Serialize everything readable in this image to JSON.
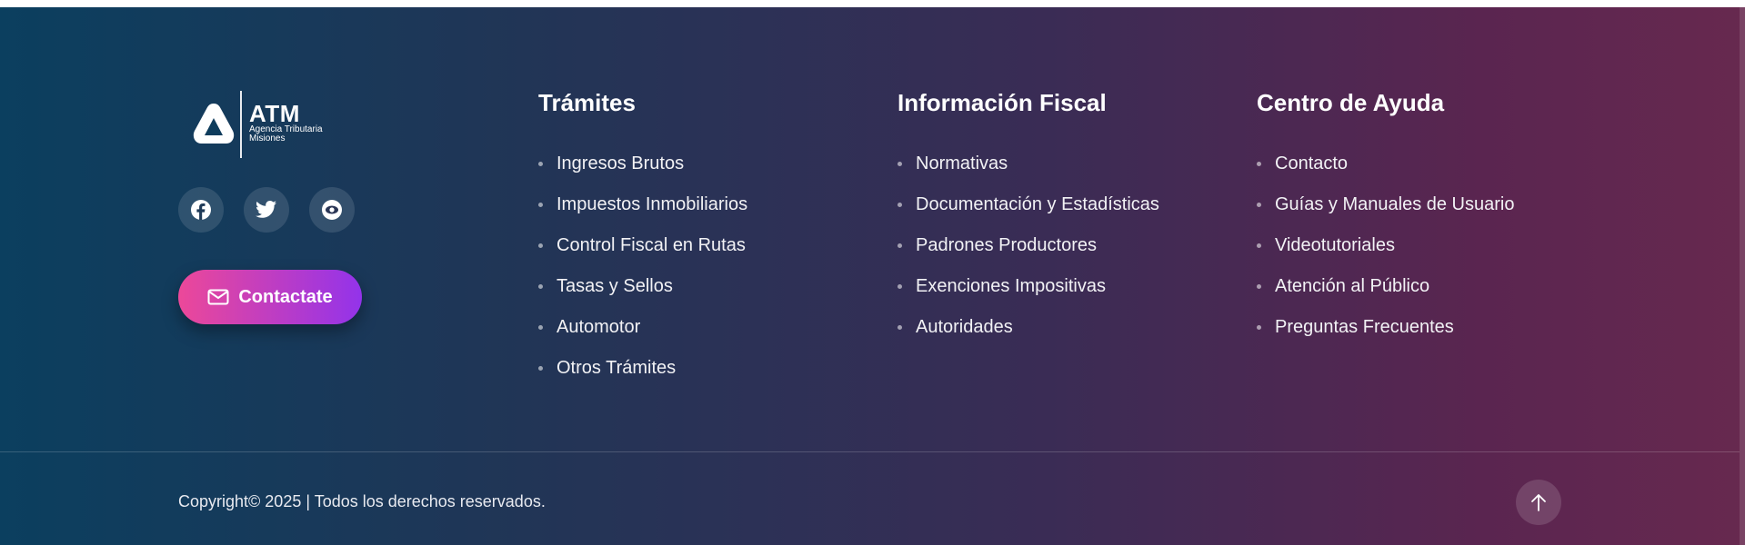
{
  "brand": {
    "name": "ATM",
    "subtitle_line1": "Agencia Tributaria",
    "subtitle_line2": "Misiones"
  },
  "social": [
    {
      "icon": "facebook-icon"
    },
    {
      "icon": "twitter-icon"
    },
    {
      "icon": "eye-icon"
    }
  ],
  "contact_button": {
    "label": "Contactate",
    "icon": "mail-icon"
  },
  "columns": {
    "tramites": {
      "title": "Trámites",
      "items": [
        "Ingresos Brutos",
        "Impuestos Inmobiliarios",
        "Control Fiscal en Rutas",
        "Tasas y Sellos",
        "Automotor",
        "Otros Trámites"
      ]
    },
    "fiscal": {
      "title": "Información Fiscal",
      "items": [
        "Normativas",
        "Documentación y Estadísticas",
        "Padrones Productores",
        "Exenciones Impositivas",
        "Autoridades"
      ]
    },
    "ayuda": {
      "title": "Centro de Ayuda",
      "items": [
        "Contacto",
        "Guías y Manuales de Usuario",
        "Videotutoriales",
        "Atención al Público",
        "Preguntas Frecuentes"
      ]
    }
  },
  "copyright": "Copyright© 2025 | Todos los derechos reservados.",
  "colors": {
    "gradient_start": "#0b3f5f",
    "gradient_end": "#67294f",
    "button_pink": "#ec4899",
    "button_purple": "#9333ea"
  }
}
